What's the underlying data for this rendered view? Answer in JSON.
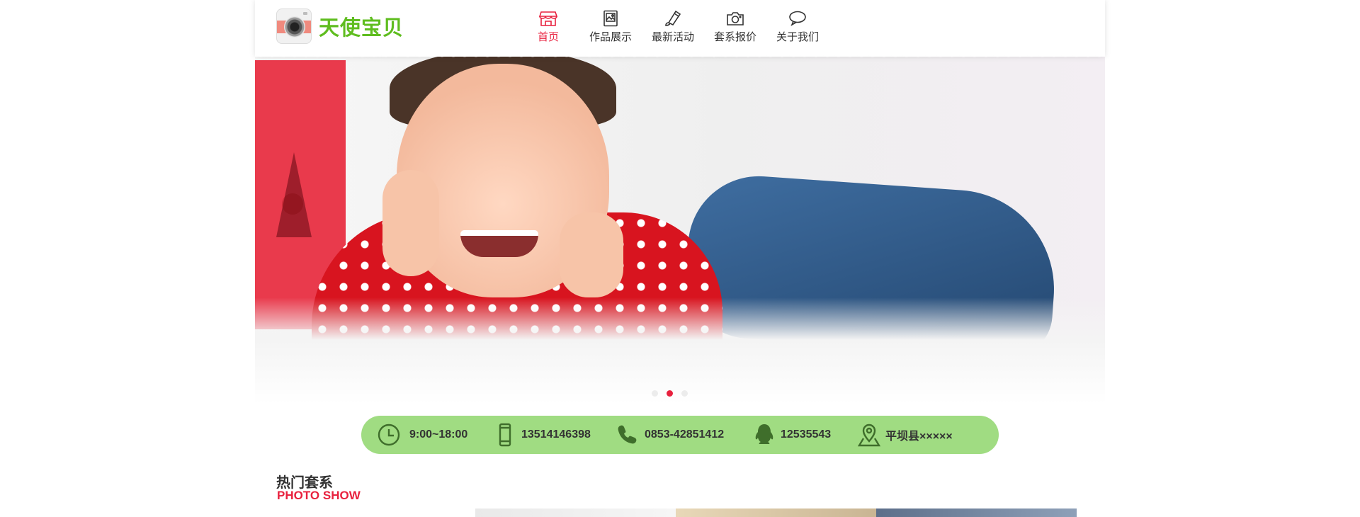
{
  "brand": {
    "name": "天使宝贝",
    "logo_icon": "camera-logo-icon"
  },
  "nav": {
    "items": [
      {
        "label": "首页",
        "icon": "store-icon",
        "active": true
      },
      {
        "label": "作品展示",
        "icon": "picture-icon",
        "active": false
      },
      {
        "label": "最新活动",
        "icon": "brush-icon",
        "active": false
      },
      {
        "label": "套系报价",
        "icon": "camera-icon",
        "active": false
      },
      {
        "label": "关于我们",
        "icon": "chat-bubble-icon",
        "active": false
      }
    ]
  },
  "slider": {
    "slide_count": 3,
    "active_slide": 2
  },
  "contact": {
    "hours": "9:00~18:00",
    "mobile": "13514146398",
    "phone": "0853-42851412",
    "qq": "12535543",
    "address": "平坝县×××××"
  },
  "section": {
    "title": "热门套系",
    "subtitle": "PHOTO SHOW"
  },
  "colors": {
    "accent": "#e8213e",
    "brand_green": "#5fbd1f",
    "info_bar": "#a0dc82"
  }
}
